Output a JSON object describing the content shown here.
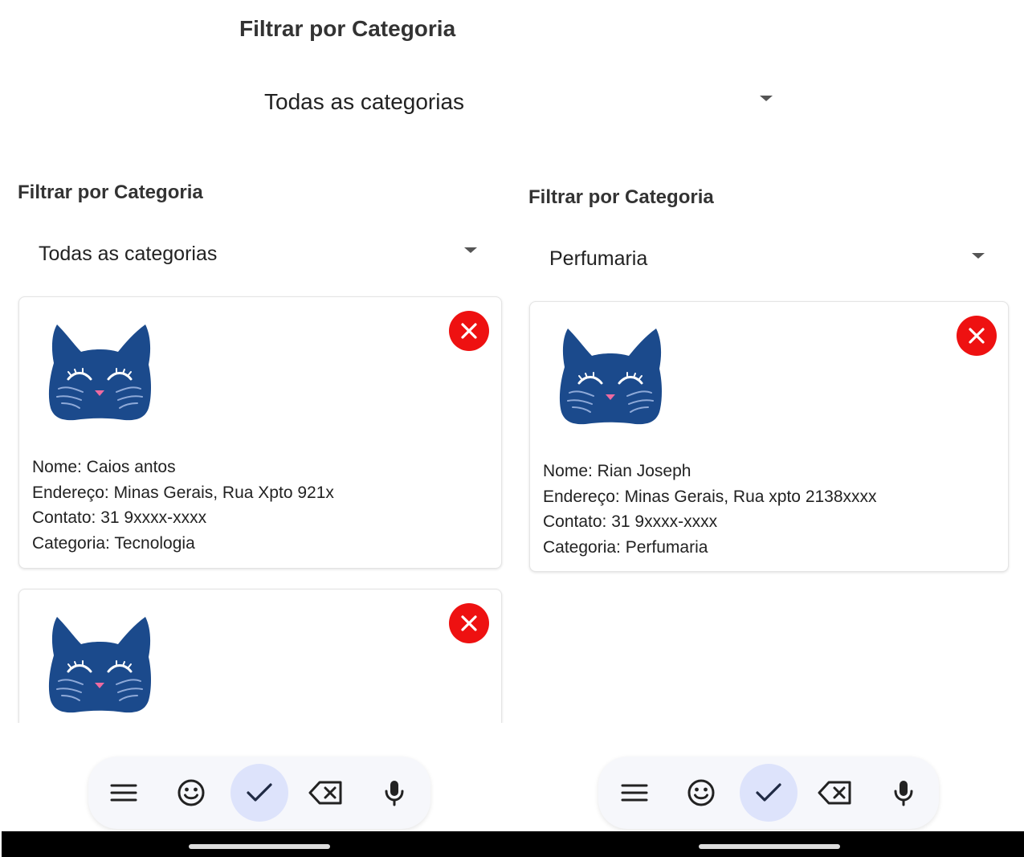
{
  "top": {
    "filter_label": "Filtrar por Categoria",
    "select_value": "Todas as categorias"
  },
  "left": {
    "filter_label": "Filtrar por Categoria",
    "select_value": "Todas as categorias",
    "cards": [
      {
        "nome": "Nome: Caios antos",
        "endereco": "Endereço: Minas Gerais, Rua Xpto 921x",
        "contato": "Contato: 31 9xxxx-xxxx",
        "categoria": "Categoria: Tecnologia"
      }
    ]
  },
  "right": {
    "filter_label": "Filtrar por Categoria",
    "select_value": "Perfumaria",
    "cards": [
      {
        "nome": "Nome: Rian Joseph",
        "endereco": "Endereço: Minas Gerais, Rua xpto 2138xxxx",
        "contato": "Contato: 31 9xxxx-xxxx",
        "categoria": "Categoria: Perfumaria"
      }
    ]
  },
  "icons": {
    "avatar": "cat-face-icon",
    "delete": "close-icon",
    "keyboard": [
      "menu-icon",
      "emoji-icon",
      "check-icon",
      "backspace-icon",
      "mic-icon"
    ]
  },
  "colors": {
    "cat": "#1b4a8c",
    "delete_button": "#ee1111",
    "active_key": "#dde3fb"
  }
}
